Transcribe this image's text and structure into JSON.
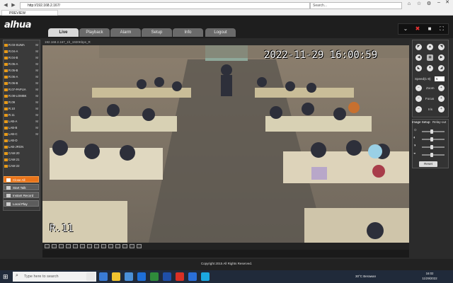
{
  "browser": {
    "address": "http://192.168.2.167/",
    "search_placeholder": "Search...",
    "tab_title": "PREVIEW"
  },
  "app": {
    "logo": "alhua",
    "tabs": [
      {
        "label": "Live",
        "active": true
      },
      {
        "label": "Playback"
      },
      {
        "label": "Alarm"
      },
      {
        "label": "Setup"
      },
      {
        "label": "Info"
      },
      {
        "label": "Logout"
      }
    ]
  },
  "devices": [
    {
      "label": "R.03-SUMA",
      "flag": "M"
    },
    {
      "label": "R.04-A",
      "flag": "M"
    },
    {
      "label": "R.04-B",
      "flag": "M"
    },
    {
      "label": "R.05-A",
      "flag": "M"
    },
    {
      "label": "R.05-B",
      "flag": "M"
    },
    {
      "label": "R.06-A",
      "flag": "M"
    },
    {
      "label": "R.06-B",
      "flag": "M"
    },
    {
      "label": "R.07-PAPUA",
      "flag": "M"
    },
    {
      "label": "R.08-LOMBK",
      "flag": "M"
    },
    {
      "label": "R.09",
      "flag": "M"
    },
    {
      "label": "R.10",
      "flag": "M"
    },
    {
      "label": "R.11",
      "flag": "M"
    },
    {
      "label": "LAB-A",
      "flag": "M"
    },
    {
      "label": "LAB-B",
      "flag": "M"
    },
    {
      "label": "LAB-C",
      "flag": "M"
    },
    {
      "label": "LAB-D",
      "flag": ""
    },
    {
      "label": "LAB-JRGN",
      "flag": ""
    },
    {
      "label": "CAM 20",
      "flag": ""
    },
    {
      "label": "CAM 21",
      "flag": ""
    },
    {
      "label": "CAM 22",
      "flag": ""
    }
  ],
  "controls": {
    "close_all": "Close All",
    "start_talk": "Start Talk",
    "instant_record": "Instant Record",
    "local_play": "Local Play"
  },
  "video": {
    "header": "192.168.2.167_1h_1920Kbps_R",
    "timestamp": "2022-11-29 16:00:59",
    "channel": "R.11"
  },
  "ptz": {
    "speed_label": "Speed(1-8)",
    "speed_value": "5",
    "zoom_label": "Zoom",
    "focus_label": "Focus",
    "iris_label": "Iris"
  },
  "image_setup": {
    "tab1": "Image Setup",
    "tab2": "Relay-out",
    "reset": "Reset"
  },
  "footer": "Copyright 2015 All Rights Reserved.",
  "taskbar": {
    "search": "Type here to search",
    "weather": "30°C  Berawan",
    "time": "16:02",
    "date": "11/29/2022"
  }
}
